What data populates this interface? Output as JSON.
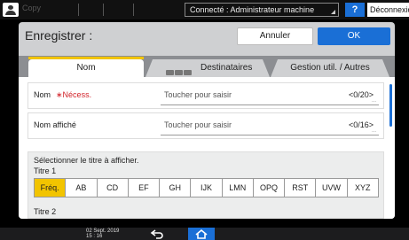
{
  "statusbar": {
    "app": "Copy",
    "connection": "Connecté : Administrateur machine",
    "help": "?",
    "logout": "Déconnexion"
  },
  "dialog": {
    "title": "Enregistrer :",
    "cancel": "Annuler",
    "ok": "OK"
  },
  "tabs": [
    {
      "label": "Nom",
      "active": true
    },
    {
      "label": "Destinataires",
      "active": false
    },
    {
      "label": "Gestion util. / Autres",
      "active": false
    }
  ],
  "fields": [
    {
      "label": "Nom",
      "required": "∗Nécess.",
      "placeholder": "Toucher pour saisir",
      "count": "<0/20>"
    },
    {
      "label": "Nom affiché",
      "placeholder": "Toucher pour saisir",
      "count": "<0/16>"
    }
  ],
  "title_section": {
    "instruction": "Sélectionner le titre à afficher.",
    "title1": "Titre 1",
    "title2": "Titre 2",
    "keys": [
      "Fréq.",
      "AB",
      "CD",
      "EF",
      "GH",
      "IJK",
      "LMN",
      "OPQ",
      "RST",
      "UVW",
      "XYZ"
    ],
    "selected": "Fréq."
  },
  "bottombar": {
    "date": "02 Sept. 2019",
    "time": "15 : 16"
  },
  "colors": {
    "accent_blue": "#1a6fd6",
    "highlight_yellow": "#f2c400",
    "required_red": "#d2232a"
  }
}
